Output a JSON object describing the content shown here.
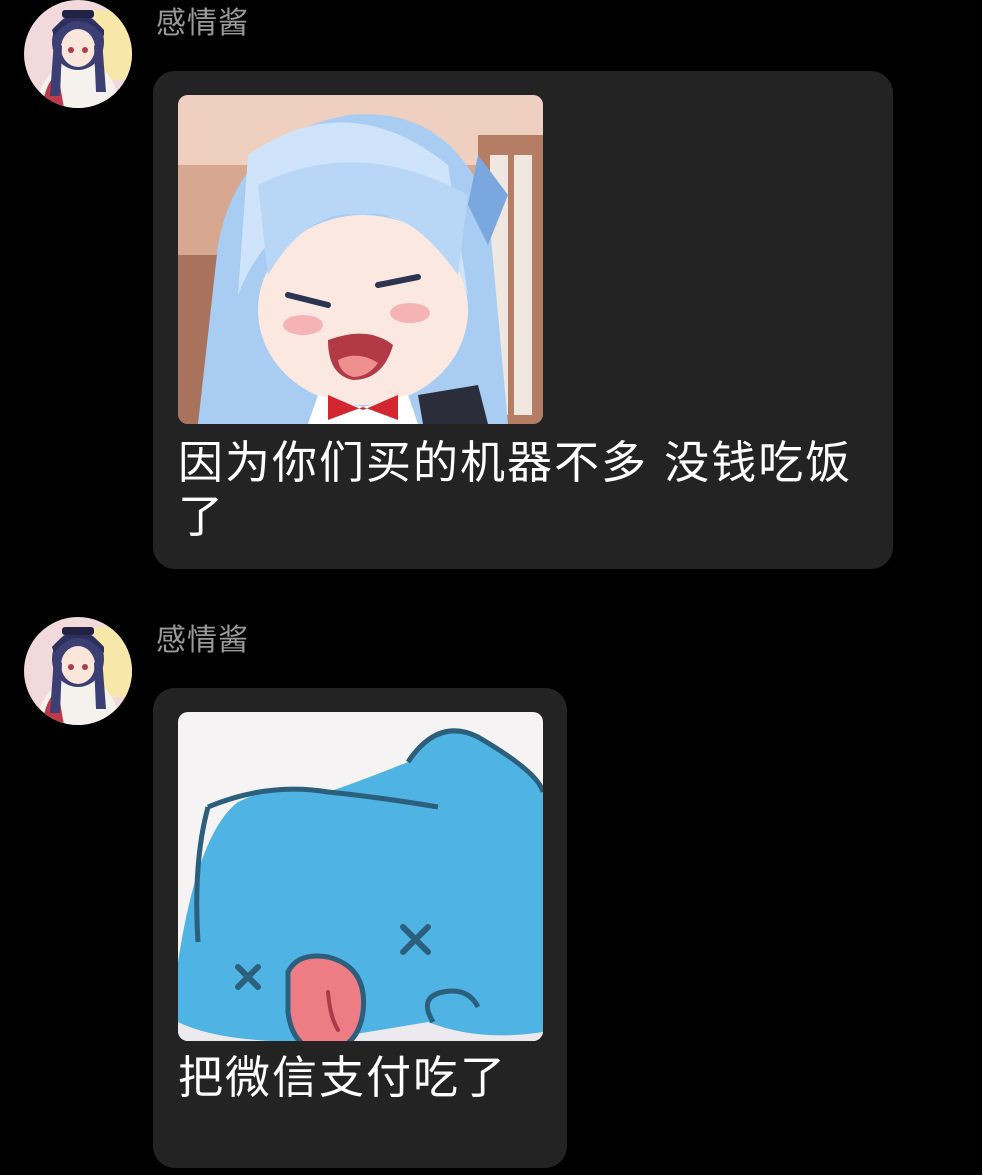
{
  "messages": [
    {
      "sender": "感情酱",
      "image": "crying-anime-girl-sticker",
      "text": "因为你们买的机器不多 没钱吃饭了"
    },
    {
      "sender": "感情酱",
      "image": "collapsed-blue-cat-sticker",
      "text": "把微信支付吃了"
    }
  ],
  "colors": {
    "background": "#000000",
    "bubble": "#222322",
    "sender_name": "#9a9a9a",
    "message_text": "#ffffff"
  }
}
